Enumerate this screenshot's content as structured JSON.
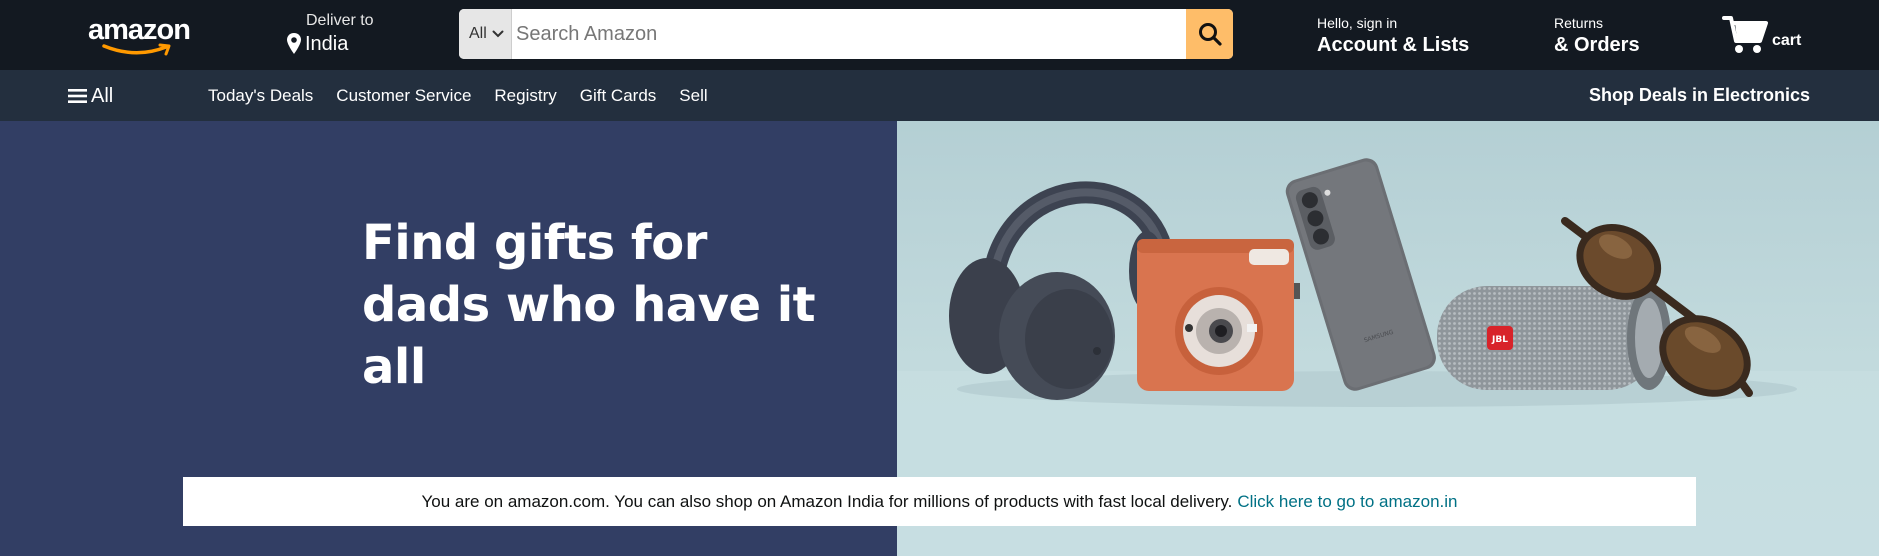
{
  "header": {
    "logo_text": "amazon",
    "deliver": {
      "line1": "Deliver to",
      "line2": "India"
    },
    "search": {
      "category": "All",
      "placeholder": "Search Amazon",
      "value": ""
    },
    "account": {
      "line1": "Hello, sign in",
      "line2": "Account & Lists"
    },
    "orders": {
      "line1": "Returns",
      "line2": "& Orders"
    },
    "cart": {
      "label": "cart"
    }
  },
  "subnav": {
    "all_label": "All",
    "links": [
      "Today's Deals",
      "Customer Service",
      "Registry",
      "Gift Cards",
      "Sell"
    ],
    "promo": "Shop Deals in Electronics"
  },
  "hero": {
    "title_line1": "Find gifts for",
    "title_line2": "dads who have it all",
    "phone_brand": "SAMSUNG",
    "speaker_brand": "JBL"
  },
  "notice": {
    "text": "You are on amazon.com. You can also shop on Amazon India for millions of products with fast local delivery.",
    "link_text": "Click here to go to amazon.in"
  },
  "colors": {
    "top_bar": "#131921",
    "sub_nav": "#232f3e",
    "search_button": "#febd69",
    "hero_left": "#323e64",
    "hero_right": "#c2dadd",
    "link": "#007185",
    "logo_smile": "#ff9900"
  }
}
